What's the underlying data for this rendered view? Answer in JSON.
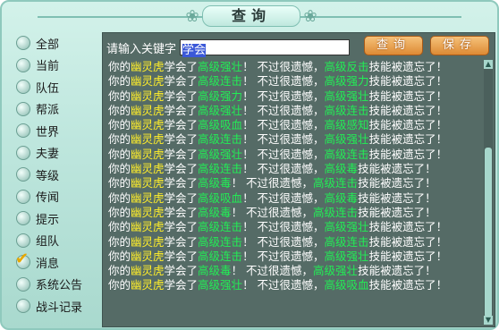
{
  "window": {
    "title": "查询"
  },
  "sidebar": {
    "items": [
      {
        "label": "全部",
        "checked": false
      },
      {
        "label": "当前",
        "checked": false
      },
      {
        "label": "队伍",
        "checked": false
      },
      {
        "label": "帮派",
        "checked": false
      },
      {
        "label": "世界",
        "checked": false
      },
      {
        "label": "夫妻",
        "checked": false
      },
      {
        "label": "等级",
        "checked": false
      },
      {
        "label": "传闻",
        "checked": false
      },
      {
        "label": "提示",
        "checked": false
      },
      {
        "label": "组队",
        "checked": false
      },
      {
        "label": "消息",
        "checked": true
      },
      {
        "label": "系统公告",
        "checked": false
      },
      {
        "label": "战斗记录",
        "checked": false
      }
    ]
  },
  "search": {
    "label": "请输入关键字",
    "value": "学会",
    "query_button": "查询",
    "save_button": "保存"
  },
  "log": {
    "lines": [
      [
        "你的",
        "幽灵虎",
        "学会了",
        "高级强壮",
        "！ 不过很遗憾，",
        "高级反击",
        "技能被遗忘了！"
      ],
      [
        "你的",
        "幽灵虎",
        "学会了",
        "高级连击",
        "！ 不过很遗憾，",
        "高级强力",
        "技能被遗忘了！"
      ],
      [
        "你的",
        "幽灵虎",
        "学会了",
        "高级强力",
        "！ 不过很遗憾，",
        "高级强壮",
        "技能被遗忘了！"
      ],
      [
        "你的",
        "幽灵虎",
        "学会了",
        "高级强壮",
        "！ 不过很遗憾，",
        "高级连击",
        "技能被遗忘了！"
      ],
      [
        "你的",
        "幽灵虎",
        "学会了",
        "高级吸血",
        "！ 不过很遗憾，",
        "高级感知",
        "技能被遗忘了！"
      ],
      [
        "你的",
        "幽灵虎",
        "学会了",
        "高级连击",
        "！ 不过很遗憾，",
        "高级强壮",
        "技能被遗忘了！"
      ],
      [
        "你的",
        "幽灵虎",
        "学会了",
        "高级强壮",
        "！ 不过很遗憾，",
        "高级连击",
        "技能被遗忘了！"
      ],
      [
        "你的",
        "幽灵虎",
        "学会了",
        "高级连击",
        "！ 不过很遗憾，",
        "高级毒",
        "技能被遗忘了！"
      ],
      [
        "你的",
        "幽灵虎",
        "学会了",
        "高级毒",
        "！ 不过很遗憾，",
        "高级连击",
        "技能被遗忘了！"
      ],
      [
        "你的",
        "幽灵虎",
        "学会了",
        "高级吸血",
        "！ 不过很遗憾，",
        "高级毒",
        "技能被遗忘了！"
      ],
      [
        "你的",
        "幽灵虎",
        "学会了",
        "高级毒",
        "！ 不过很遗憾，",
        "高级连击",
        "技能被遗忘了！"
      ],
      [
        "你的",
        "幽灵虎",
        "学会了",
        "高级连击",
        "！ 不过很遗憾，",
        "高级强壮",
        "技能被遗忘了！"
      ],
      [
        "你的",
        "幽灵虎",
        "学会了",
        "高级连击",
        "！ 不过很遗憾，",
        "高级连击",
        "技能被遗忘了！"
      ],
      [
        "你的",
        "幽灵虎",
        "学会了",
        "高级连击",
        "！ 不过很遗憾，",
        "高级强壮",
        "技能被遗忘了！"
      ],
      [
        "你的",
        "幽灵虎",
        "学会了",
        "高级毒",
        "！ 不过很遗憾，",
        "高级强壮",
        "技能被遗忘了！"
      ],
      [
        "你的",
        "幽灵虎",
        "学会了",
        "高级强壮",
        "！ 不过很遗憾，",
        "高级吸血",
        "技能被遗忘了！"
      ]
    ]
  },
  "colors": {
    "pet_name": "#ffee2a",
    "skill": "#22ee55",
    "text": "#ffffff",
    "panel_bg": "#556b66"
  }
}
